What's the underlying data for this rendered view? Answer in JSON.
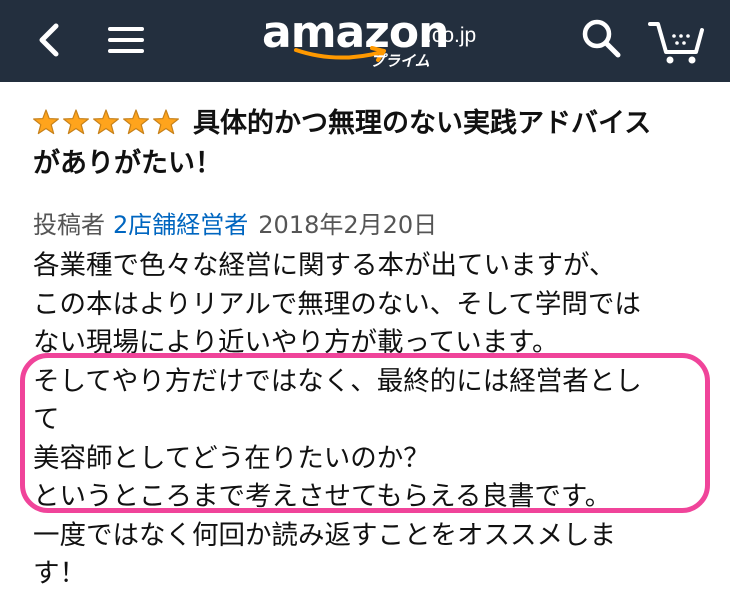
{
  "header": {
    "logo_word": "amazon",
    "logo_tld": ".co.jp",
    "logo_prime": "プライム",
    "icons": [
      "back-icon",
      "menu-icon",
      "search-icon",
      "cart-icon"
    ],
    "background_color": "#232f3e",
    "accent_color": "#ff9900"
  },
  "review": {
    "rating": 5,
    "rating_max": 5,
    "star_color": "#ffa41c",
    "title_line1": "具体的かつ無理のない実践アドバイス",
    "title_line2": "がありがたい！",
    "author_prefix": "投稿者",
    "author": "2店舗経営者",
    "date": "2018年2月20日",
    "body_lines": [
      "各業種で色々な経営に関する本が出ていますが、",
      "この本はよりリアルで無理のない、そして学問では",
      "ない現場により近いやり方が載っています。",
      "そしてやり方だけではなく、最終的には経営者とし",
      "て",
      "美容師としてどう在りたいのか？",
      "というところまで考えさせてもらえる良書です。",
      "一度ではなく何回か読み返すことをオススメしま",
      "す！"
    ],
    "highlight_color": "#f0449a"
  }
}
